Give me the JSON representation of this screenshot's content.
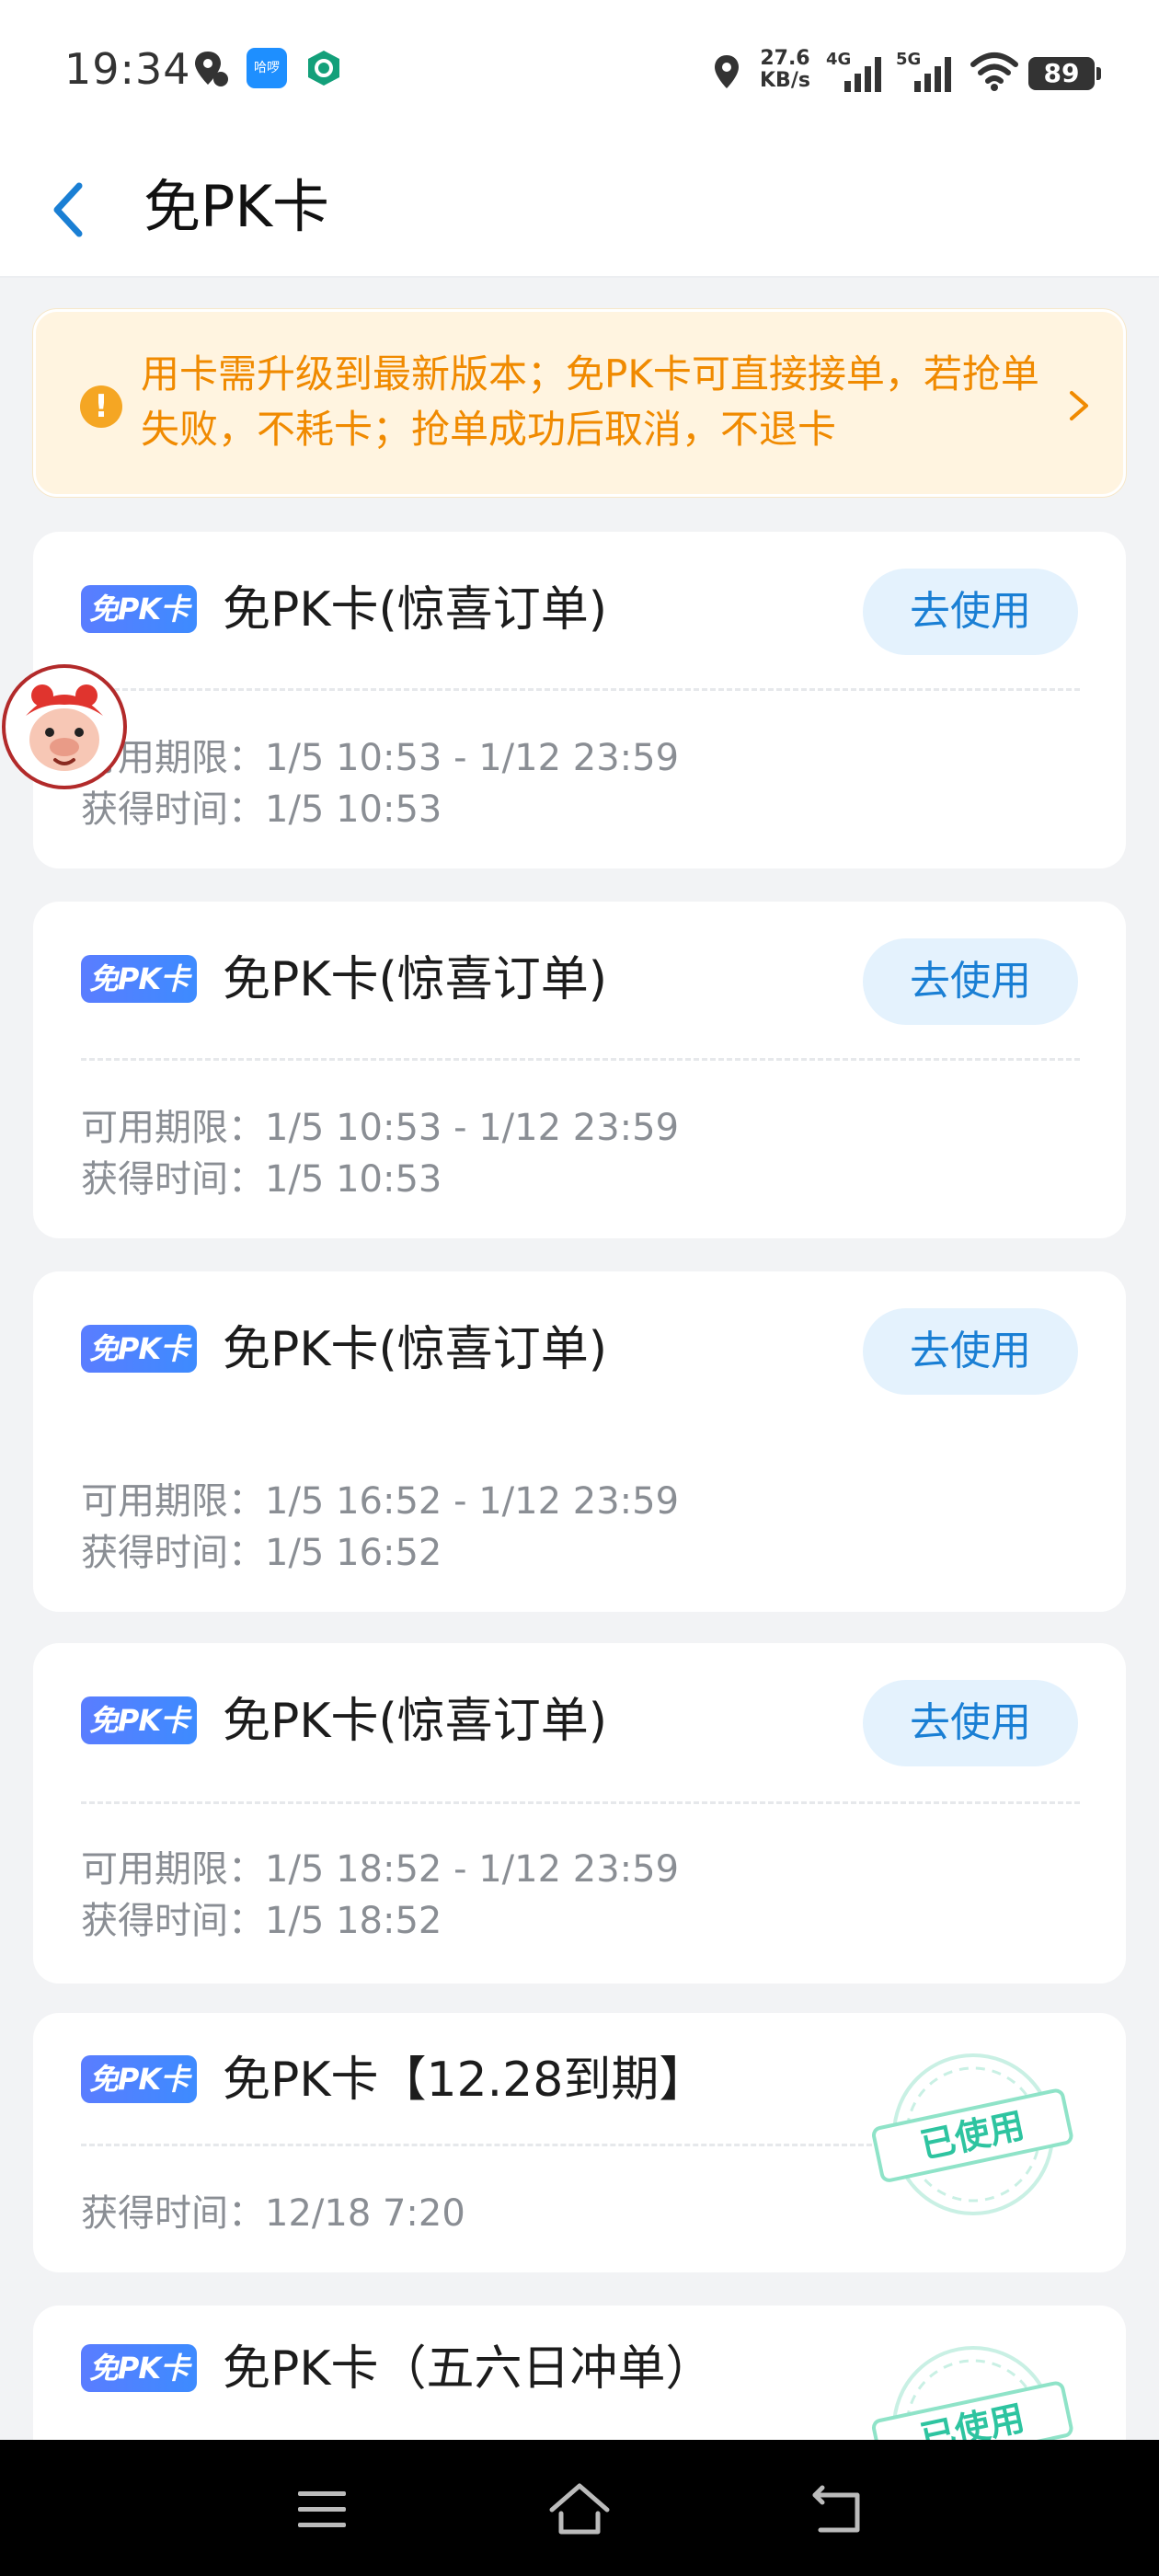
{
  "status_bar": {
    "time": "19:34",
    "net_speed_value": "27.6",
    "net_speed_unit": "KB/s",
    "sig1_label": "4G",
    "sig2_label": "5G",
    "battery": "89",
    "app_icon_text": "哈啰"
  },
  "header": {
    "title": "免PK卡"
  },
  "notice": {
    "text": "用卡需升级到最新版本；免PK卡可直接接单，若抢单失败，不耗卡；抢单成功后取消，不退卡",
    "icon_symbol": "!"
  },
  "cards": [
    {
      "badge": "免PK卡",
      "title": "免PK卡(惊喜订单)",
      "button": "去使用",
      "valid": "可用期限：1/5 10:53 - 1/12 23:59",
      "obtained": "获得时间：1/5 10:53"
    },
    {
      "badge": "免PK卡",
      "title": "免PK卡(惊喜订单)",
      "button": "去使用",
      "valid": "可用期限：1/5 10:53 - 1/12 23:59",
      "obtained": "获得时间：1/5 10:53"
    },
    {
      "badge": "免PK卡",
      "title": "免PK卡(惊喜订单)",
      "button": "去使用",
      "valid": "可用期限：1/5 16:52 - 1/12 23:59",
      "obtained": "获得时间：1/5 16:52"
    },
    {
      "badge": "免PK卡",
      "title": "免PK卡(惊喜订单)",
      "button": "去使用",
      "valid": "可用期限：1/5 18:52 - 1/12 23:59",
      "obtained": "获得时间：1/5 18:52"
    },
    {
      "badge": "免PK卡",
      "title": "免PK卡【12.28到期】",
      "stamp": "已使用",
      "obtained": "获得时间：12/18 7:20"
    },
    {
      "badge": "免PK卡",
      "title": "免PK卡（五六日冲单）",
      "stamp": "已使用"
    }
  ],
  "colors": {
    "accent_blue": "#1a7fd4",
    "notice_text": "#f08a00",
    "notice_bg": "#fff4e0",
    "stamp_green": "#2ec4a0",
    "badge_blue": "#4a84ff"
  },
  "icons": {
    "back": "chevron-left-icon",
    "notice": "warning-circle-icon",
    "notice_arrow": "chevron-right-icon",
    "nav": [
      "menu-icon",
      "home-icon",
      "back-arrow-icon"
    ]
  }
}
